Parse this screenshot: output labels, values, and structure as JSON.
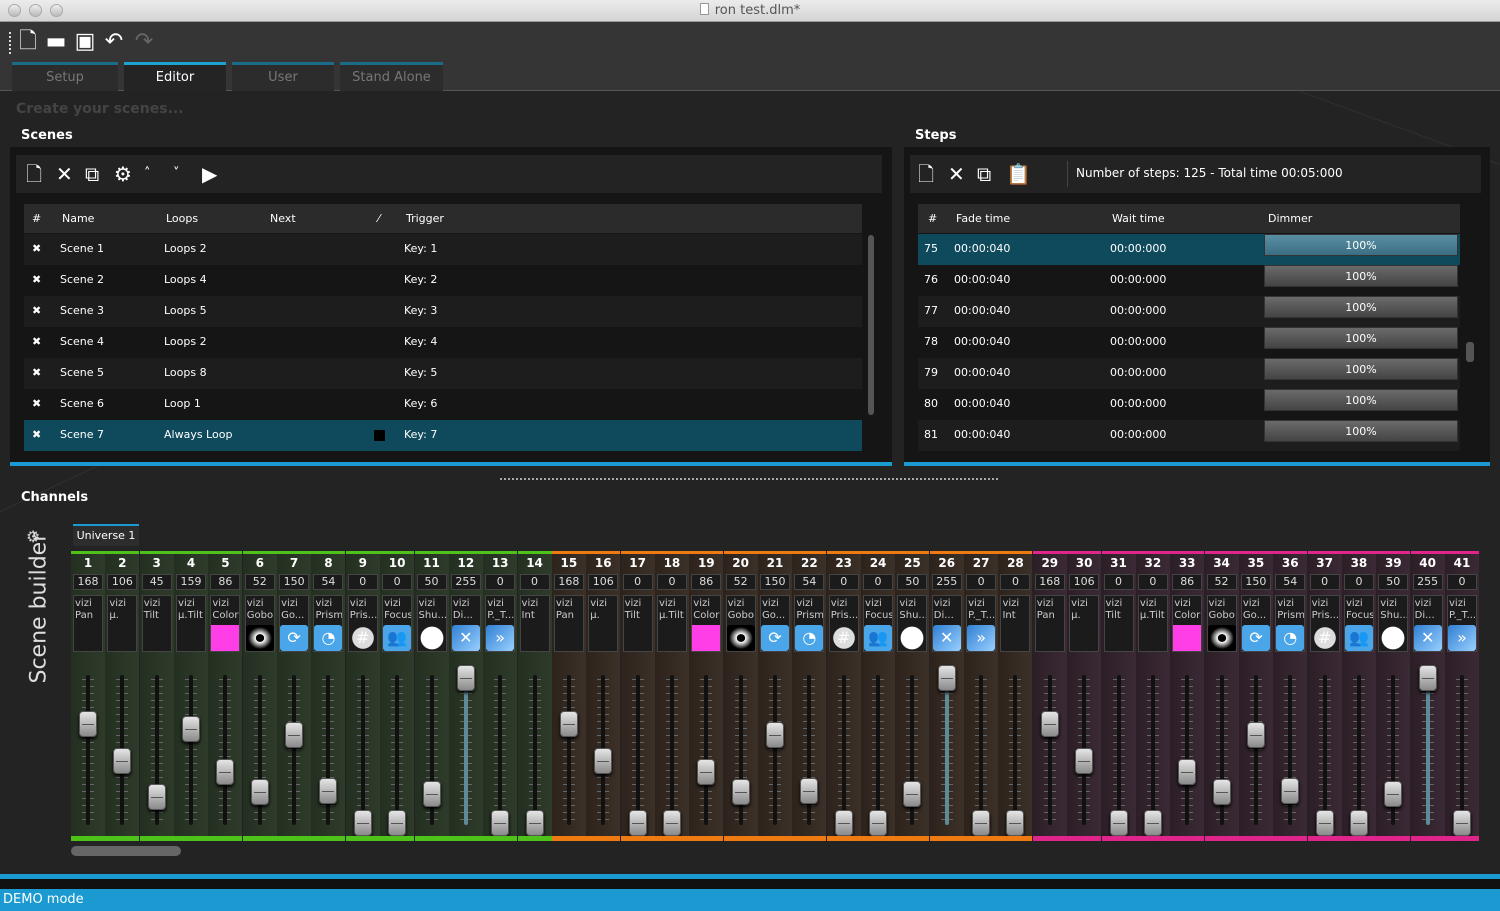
{
  "window": {
    "title": "ron test.dlm*"
  },
  "toolbar": {
    "icons": [
      "new-file-icon",
      "open-folder-icon",
      "save-icon",
      "undo-icon",
      "redo-icon"
    ]
  },
  "tabs": [
    {
      "label": "Setup",
      "active": false
    },
    {
      "label": "Editor",
      "active": true
    },
    {
      "label": "User",
      "active": false
    },
    {
      "label": "Stand Alone",
      "active": false
    }
  ],
  "hint": "Create your scenes...",
  "scenes": {
    "title": "Scenes",
    "toolbar_icons": [
      "add-scene-icon",
      "delete-icon",
      "copy-icon",
      "settings-icon",
      "move-up-icon",
      "move-down-icon",
      "play-icon"
    ],
    "columns": {
      "num": "#",
      "name": "Name",
      "loops": "Loops",
      "next": "Next",
      "edit": "⁄",
      "trigger": "Trigger"
    },
    "rows": [
      {
        "name": "Scene 1",
        "loops": "Loops 2",
        "trigger": "Key: 1",
        "selected": false
      },
      {
        "name": "Scene 2",
        "loops": "Loops 4",
        "trigger": "Key: 2",
        "selected": false
      },
      {
        "name": "Scene 3",
        "loops": "Loops 5",
        "trigger": "Key: 3",
        "selected": false
      },
      {
        "name": "Scene 4",
        "loops": "Loops 2",
        "trigger": "Key: 4",
        "selected": false
      },
      {
        "name": "Scene 5",
        "loops": "Loops 8",
        "trigger": "Key: 5",
        "selected": false
      },
      {
        "name": "Scene 6",
        "loops": "Loop 1",
        "trigger": "Key: 6",
        "selected": false
      },
      {
        "name": "Scene 7",
        "loops": "Always Loop",
        "trigger": "Key: 7",
        "selected": true
      }
    ]
  },
  "steps": {
    "title": "Steps",
    "summary": "Number of steps: 125 - Total time 00:05:000",
    "toolbar_icons": [
      "add-step-icon",
      "delete-icon",
      "copy-step-icon",
      "paste-step-icon"
    ],
    "columns": {
      "num": "#",
      "fade": "Fade time",
      "wait": "Wait time",
      "dimmer": "Dimmer"
    },
    "rows": [
      {
        "num": "75",
        "fade": "00:00:040",
        "wait": "00:00:000",
        "dimmer": "100%",
        "selected": true
      },
      {
        "num": "76",
        "fade": "00:00:040",
        "wait": "00:00:000",
        "dimmer": "100%",
        "selected": false
      },
      {
        "num": "77",
        "fade": "00:00:040",
        "wait": "00:00:000",
        "dimmer": "100%",
        "selected": false
      },
      {
        "num": "78",
        "fade": "00:00:040",
        "wait": "00:00:000",
        "dimmer": "100%",
        "selected": false
      },
      {
        "num": "79",
        "fade": "00:00:040",
        "wait": "00:00:000",
        "dimmer": "100%",
        "selected": false
      },
      {
        "num": "80",
        "fade": "00:00:040",
        "wait": "00:00:000",
        "dimmer": "100%",
        "selected": false
      },
      {
        "num": "81",
        "fade": "00:00:040",
        "wait": "00:00:000",
        "dimmer": "100%",
        "selected": false
      }
    ]
  },
  "channels": {
    "title": "Channels",
    "side_label": "Scene builder",
    "universe_tab": "Universe 1",
    "group_colors": {
      "g": "#4fc21a",
      "o": "#f07a12",
      "p": "#e0248c"
    },
    "list": [
      {
        "n": "1",
        "v": 168,
        "l1": "vizi",
        "l2": "Pan",
        "icon": "",
        "g": "g"
      },
      {
        "n": "2",
        "v": 106,
        "l1": "vizi",
        "l2": "µ.",
        "icon": "",
        "g": "g"
      },
      {
        "n": "3",
        "v": 45,
        "l1": "vizi",
        "l2": "Tilt",
        "icon": "",
        "g": "g"
      },
      {
        "n": "4",
        "v": 159,
        "l1": "vizi",
        "l2": "µ.Tilt",
        "icon": "",
        "g": "g"
      },
      {
        "n": "5",
        "v": 86,
        "l1": "vizi",
        "l2": "Color",
        "icon": "color",
        "g": "g"
      },
      {
        "n": "6",
        "v": 52,
        "l1": "vizi",
        "l2": "Gobo",
        "icon": "gobo",
        "g": "g"
      },
      {
        "n": "7",
        "v": 150,
        "l1": "vizi",
        "l2": "Go...",
        "icon": "rotate",
        "g": "g"
      },
      {
        "n": "8",
        "v": 54,
        "l1": "vizi",
        "l2": "Prism",
        "icon": "prism",
        "g": "g"
      },
      {
        "n": "9",
        "v": 0,
        "l1": "vizi",
        "l2": "Pris...",
        "icon": "prism2",
        "g": "g"
      },
      {
        "n": "10",
        "v": 0,
        "l1": "vizi",
        "l2": "Focus",
        "icon": "focus",
        "g": "g"
      },
      {
        "n": "11",
        "v": 50,
        "l1": "vizi",
        "l2": "Shu...",
        "icon": "shutter",
        "g": "g"
      },
      {
        "n": "12",
        "v": 255,
        "l1": "vizi",
        "l2": "Di...",
        "icon": "dimmer",
        "g": "g"
      },
      {
        "n": "13",
        "v": 0,
        "l1": "vizi",
        "l2": "P._T...",
        "icon": "pt",
        "g": "g"
      },
      {
        "n": "14",
        "v": 0,
        "l1": "vizi",
        "l2": "Int",
        "icon": "",
        "g": "g"
      },
      {
        "n": "15",
        "v": 168,
        "l1": "vizi",
        "l2": "Pan",
        "icon": "",
        "g": "o"
      },
      {
        "n": "16",
        "v": 106,
        "l1": "vizi",
        "l2": "µ.",
        "icon": "",
        "g": "o"
      },
      {
        "n": "17",
        "v": 0,
        "l1": "vizi",
        "l2": "Tilt",
        "icon": "",
        "g": "o"
      },
      {
        "n": "18",
        "v": 0,
        "l1": "vizi",
        "l2": "µ.Tilt",
        "icon": "",
        "g": "o"
      },
      {
        "n": "19",
        "v": 86,
        "l1": "vizi",
        "l2": "Color",
        "icon": "color",
        "g": "o"
      },
      {
        "n": "20",
        "v": 52,
        "l1": "vizi",
        "l2": "Gobo",
        "icon": "gobo",
        "g": "o"
      },
      {
        "n": "21",
        "v": 150,
        "l1": "vizi",
        "l2": "Go...",
        "icon": "rotate",
        "g": "o"
      },
      {
        "n": "22",
        "v": 54,
        "l1": "vizi",
        "l2": "Prism",
        "icon": "prism",
        "g": "o"
      },
      {
        "n": "23",
        "v": 0,
        "l1": "vizi",
        "l2": "Pris...",
        "icon": "prism2",
        "g": "o"
      },
      {
        "n": "24",
        "v": 0,
        "l1": "vizi",
        "l2": "Focus",
        "icon": "focus",
        "g": "o"
      },
      {
        "n": "25",
        "v": 50,
        "l1": "vizi",
        "l2": "Shu...",
        "icon": "shutter",
        "g": "o"
      },
      {
        "n": "26",
        "v": 255,
        "l1": "vizi",
        "l2": "Di...",
        "icon": "dimmer",
        "g": "o"
      },
      {
        "n": "27",
        "v": 0,
        "l1": "vizi",
        "l2": "P._T...",
        "icon": "pt",
        "g": "o"
      },
      {
        "n": "28",
        "v": 0,
        "l1": "vizi",
        "l2": "Int",
        "icon": "",
        "g": "o"
      },
      {
        "n": "29",
        "v": 168,
        "l1": "vizi",
        "l2": "Pan",
        "icon": "",
        "g": "p"
      },
      {
        "n": "30",
        "v": 106,
        "l1": "vizi",
        "l2": "µ.",
        "icon": "",
        "g": "p"
      },
      {
        "n": "31",
        "v": 0,
        "l1": "vizi",
        "l2": "Tilt",
        "icon": "",
        "g": "p"
      },
      {
        "n": "32",
        "v": 0,
        "l1": "vizi",
        "l2": "µ.Tilt",
        "icon": "",
        "g": "p"
      },
      {
        "n": "33",
        "v": 86,
        "l1": "vizi",
        "l2": "Color",
        "icon": "color",
        "g": "p"
      },
      {
        "n": "34",
        "v": 52,
        "l1": "vizi",
        "l2": "Gobo",
        "icon": "gobo",
        "g": "p"
      },
      {
        "n": "35",
        "v": 150,
        "l1": "vizi",
        "l2": "Go...",
        "icon": "rotate",
        "g": "p"
      },
      {
        "n": "36",
        "v": 54,
        "l1": "vizi",
        "l2": "Prism",
        "icon": "prism",
        "g": "p"
      },
      {
        "n": "37",
        "v": 0,
        "l1": "vizi",
        "l2": "Pris...",
        "icon": "prism2",
        "g": "p"
      },
      {
        "n": "38",
        "v": 0,
        "l1": "vizi",
        "l2": "Focus",
        "icon": "focus",
        "g": "p"
      },
      {
        "n": "39",
        "v": 50,
        "l1": "vizi",
        "l2": "Shu...",
        "icon": "shutter",
        "g": "p"
      },
      {
        "n": "40",
        "v": 255,
        "l1": "vizi",
        "l2": "Di...",
        "icon": "dimmer",
        "g": "p"
      },
      {
        "n": "41",
        "v": 0,
        "l1": "vizi",
        "l2": "P._T...",
        "icon": "pt",
        "g": "p"
      }
    ]
  },
  "status": {
    "text": "DEMO mode"
  }
}
